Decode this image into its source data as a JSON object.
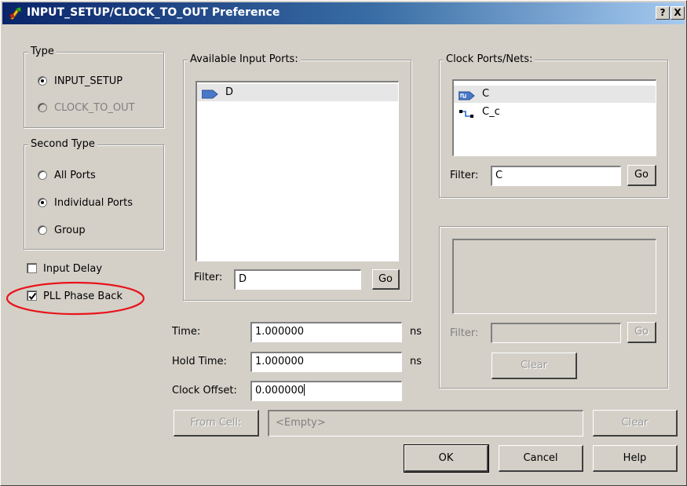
{
  "window": {
    "title": "INPUT_SETUP/CLOCK_TO_OUT Preference",
    "help_button": "?",
    "close_button": "X"
  },
  "type_group": {
    "legend": "Type",
    "options": [
      {
        "label": "INPUT_SETUP",
        "selected": true,
        "enabled": true
      },
      {
        "label": "CLOCK_TO_OUT",
        "selected": false,
        "enabled": false
      }
    ]
  },
  "second_type_group": {
    "legend": "Second Type",
    "options": [
      {
        "label": "All Ports",
        "selected": false
      },
      {
        "label": "Individual Ports",
        "selected": true
      },
      {
        "label": "Group",
        "selected": false
      }
    ]
  },
  "checkboxes": {
    "input_delay": {
      "label": "Input Delay",
      "checked": false
    },
    "pll_phase_back": {
      "label": "PLL Phase Back",
      "checked": true
    }
  },
  "annotation": {
    "color": "#e8141b"
  },
  "available_input_ports": {
    "legend": "Available Input Ports:",
    "items": [
      {
        "label": "D",
        "icon": "input-port-icon"
      }
    ],
    "filter_label": "Filter:",
    "filter_value": "D",
    "go_label": "Go"
  },
  "clock_ports": {
    "legend": "Clock Ports/Nets:",
    "items": [
      {
        "label": "C",
        "icon": "clock-port-icon"
      },
      {
        "label": "C_c",
        "icon": "net-icon"
      }
    ],
    "filter_label": "Filter:",
    "filter_value": "C",
    "go_label": "Go"
  },
  "secondary_panel": {
    "filter_label": "Filter:",
    "filter_value": "",
    "go_label": "Go",
    "clear_label": "Clear"
  },
  "timing": {
    "time_label": "Time:",
    "time_value": "1.000000",
    "time_unit": "ns",
    "hold_label": "Hold Time:",
    "hold_value": "1.000000",
    "hold_unit": "ns",
    "offset_label": "Clock Offset:",
    "offset_value": "0.000000"
  },
  "from_cell": {
    "button_label": "From Cell:",
    "value": "<Empty>",
    "clear_label": "Clear"
  },
  "footer": {
    "ok_label": "OK",
    "cancel_label": "Cancel",
    "help_label": "Help"
  }
}
